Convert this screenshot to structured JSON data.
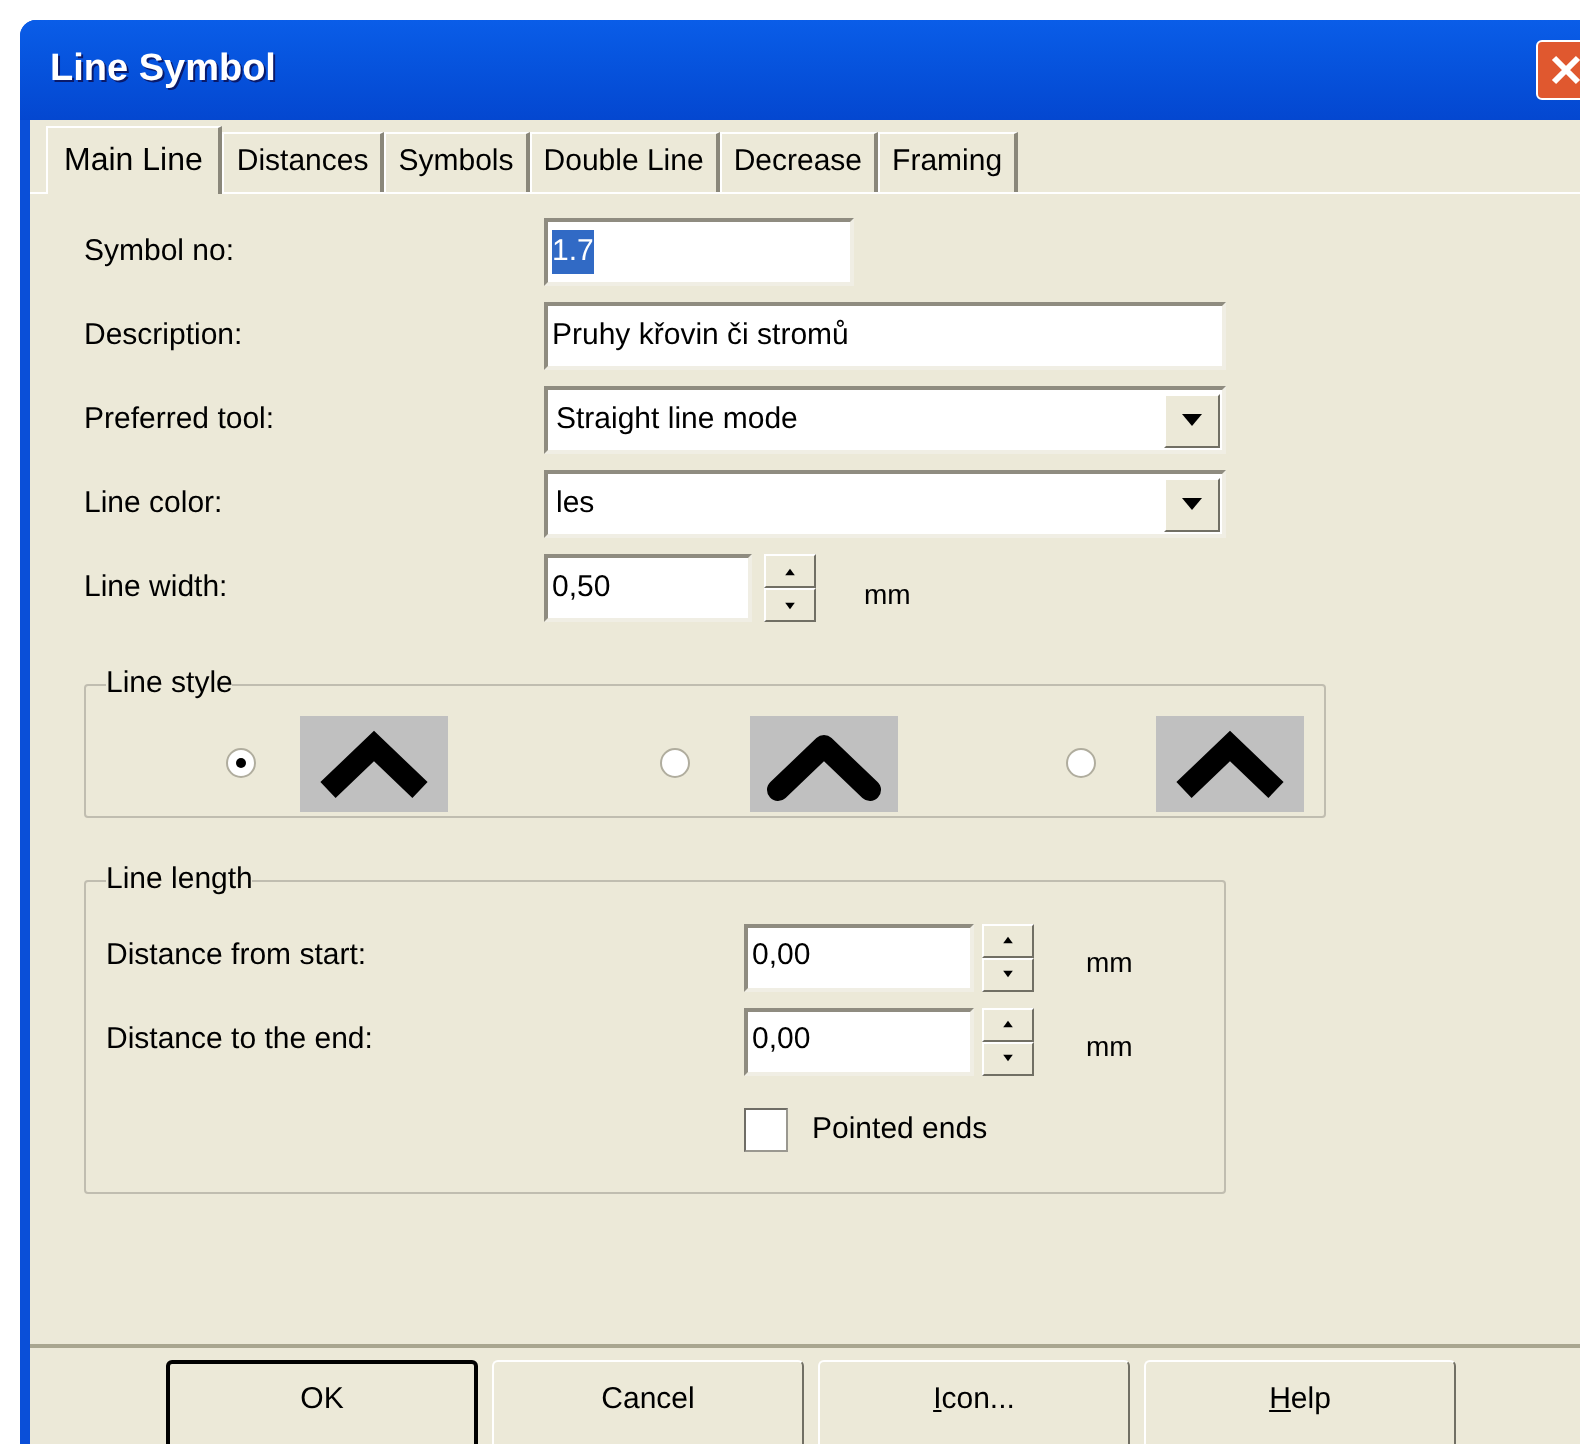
{
  "window": {
    "title": "Line Symbol"
  },
  "tabs": [
    {
      "label": "Main Line",
      "selected": true
    },
    {
      "label": "Distances",
      "selected": false
    },
    {
      "label": "Symbols",
      "selected": false
    },
    {
      "label": "Double Line",
      "selected": false
    },
    {
      "label": "Decrease",
      "selected": false
    },
    {
      "label": "Framing",
      "selected": false
    }
  ],
  "fields": [
    {
      "kind": "text",
      "label": "Symbol no:",
      "value": "1.7",
      "highlighted": true
    },
    {
      "kind": "text",
      "label": "Description:",
      "value": "Pruhy křovin či stromů",
      "highlighted": false
    },
    {
      "kind": "dropdown",
      "label": "Preferred tool:",
      "value": "Straight line mode"
    },
    {
      "kind": "dropdown",
      "label": "Line color:",
      "value": "les"
    },
    {
      "kind": "spin",
      "label": "Line width:",
      "value": "0,50",
      "unit": "mm"
    }
  ],
  "line_style": {
    "title": "Line style",
    "options": [
      {
        "kind": "flat",
        "selected": true
      },
      {
        "kind": "round",
        "selected": false
      },
      {
        "kind": "pointed",
        "selected": false
      }
    ]
  },
  "line_length": {
    "title": "Line length",
    "rows": [
      {
        "label": "Distance from start:",
        "value": "0,00",
        "unit": "mm"
      },
      {
        "label": "Distance to the end:",
        "value": "0,00",
        "unit": "mm"
      }
    ],
    "checkbox": {
      "label": "Pointed ends",
      "checked": false
    }
  },
  "buttons": [
    {
      "label": "OK",
      "default": true
    },
    {
      "label": "Cancel",
      "default": false
    },
    {
      "access_key": "I",
      "label_rest": "con...",
      "default": false
    },
    {
      "access_key": "H",
      "label_rest": "elp",
      "default": false
    }
  ]
}
